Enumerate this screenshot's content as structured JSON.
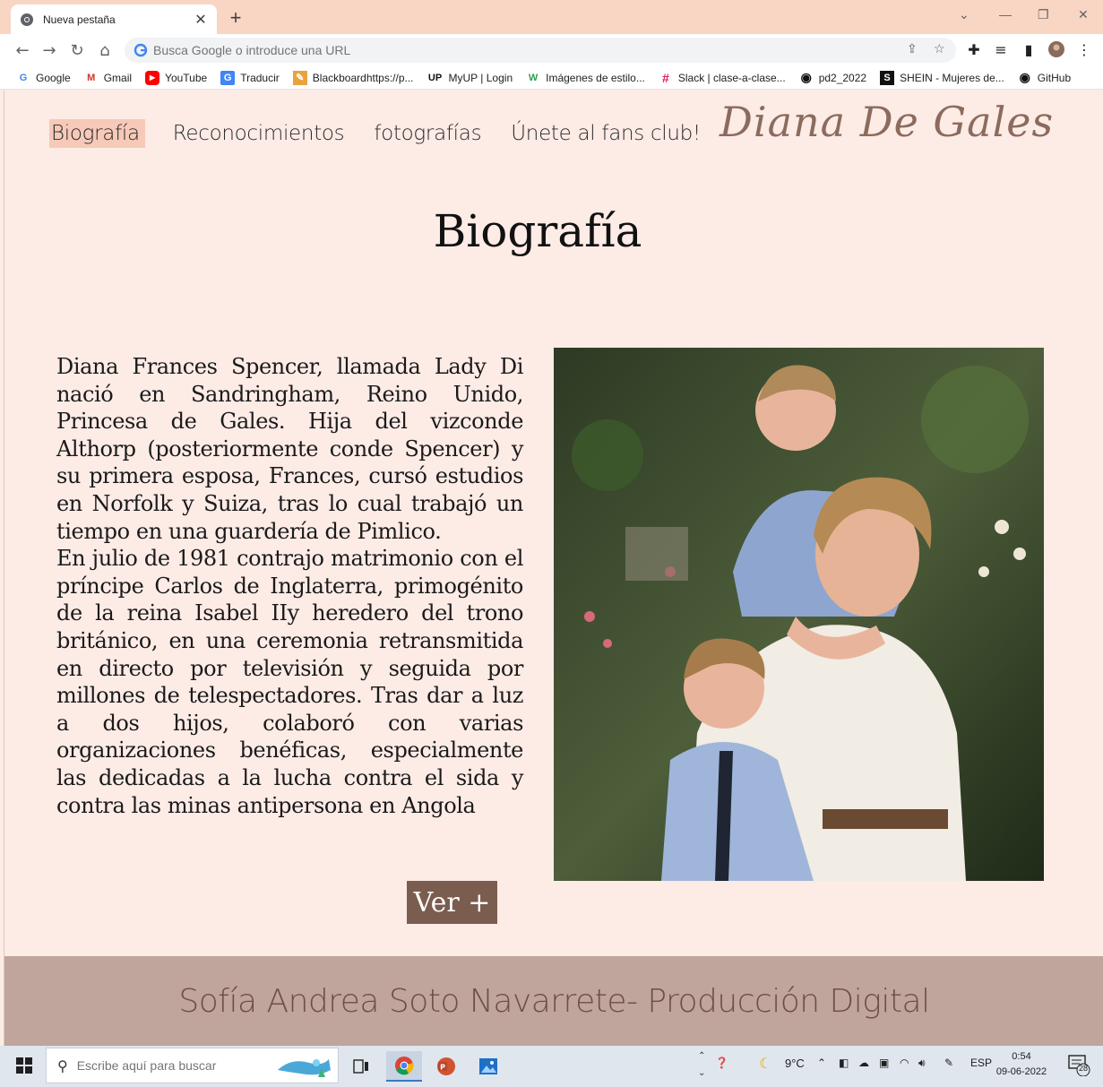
{
  "browser": {
    "tab_title": "Nueva pestaña",
    "new_tab_symbol": "+",
    "omnibox_placeholder": "Busca Google o introduce una URL",
    "bookmarks": [
      {
        "label": "Google",
        "icon": "G"
      },
      {
        "label": "Gmail",
        "icon": "M"
      },
      {
        "label": "YouTube",
        "icon": "▶"
      },
      {
        "label": "Traducir",
        "icon": "G"
      },
      {
        "label": "Blackboardhttps://p...",
        "icon": "✎"
      },
      {
        "label": "MyUP | Login",
        "icon": "UP"
      },
      {
        "label": "Imágenes de estilo...",
        "icon": "W"
      },
      {
        "label": "Slack | clase-a-clase...",
        "icon": "#"
      },
      {
        "label": "pd2_2022",
        "icon": "◉"
      },
      {
        "label": "SHEIN - Mujeres de...",
        "icon": "S"
      },
      {
        "label": "GitHub",
        "icon": "◉"
      }
    ]
  },
  "site": {
    "nav": [
      "Biografía",
      "Reconocimientos",
      "fotografías",
      "Únete al fans club!"
    ],
    "brand": "Diana De Gales",
    "heading": "Biografía",
    "bio_p1": "Diana Frances Spencer, llamada Lady Di nació en  Sandringham, Reino Unido, Princesa de Gales. Hija del vizconde Althorp (posteriormente conde Spencer) y su primera esposa, Frances, cursó estudios en Norfolk y Suiza, tras lo cual trabajó un tiempo en una guardería de Pimlico.",
    "bio_p2": "En julio de 1981 contrajo matrimonio con el príncipe Carlos de Inglaterra, primogénito de la reina Isabel IIy heredero del trono británico, en una ceremonia retransmitida en directo por televisión y seguida por millones de telespectadores. Tras dar a luz a dos hijos, colaboró con varias organizaciones benéficas, especialmente las dedicadas a la lucha contra el sida y contra las minas antipersona en Angola",
    "more_button": "Ver +",
    "footer": "Sofía Andrea Soto Navarrete- Producción Digital"
  },
  "taskbar": {
    "search_placeholder": "Escribe aquí para buscar",
    "weather": "9°C",
    "language": "ESP",
    "time": "0:54",
    "date": "09-06-2022",
    "notifications": "28"
  },
  "colors": {
    "page_bg": "#fdebe6",
    "nav_active": "#f6c9b8",
    "button_bg": "#7b5d50",
    "footer_bg": "#bfa59b",
    "footer_text": "#6d5045",
    "tabstrip": "#f9d5c4"
  }
}
